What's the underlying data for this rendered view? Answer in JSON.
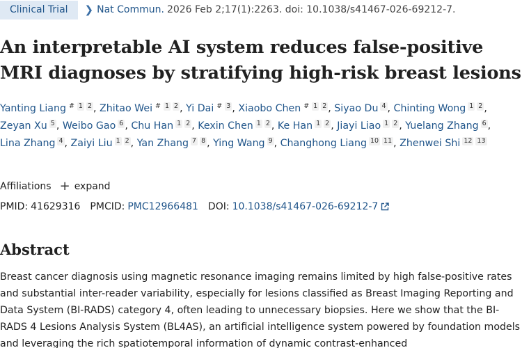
{
  "header": {
    "badge": "Clinical Trial",
    "journal": "Nat Commun.",
    "citation": "2026 Feb 2;17(1):2263. doi: 10.1038/s41467-026-69212-7."
  },
  "title": "An interpretable AI system reduces false-positive MRI diagnoses by stratifying high-risk breast lesions",
  "authors": [
    {
      "name": "Yanting Liang",
      "marks": [
        "#",
        "1",
        "2"
      ]
    },
    {
      "name": "Zhitao Wei",
      "marks": [
        "#",
        "1",
        "2"
      ]
    },
    {
      "name": "Yi Dai",
      "marks": [
        "#",
        "3"
      ]
    },
    {
      "name": "Xiaobo Chen",
      "marks": [
        "#",
        "1",
        "2"
      ]
    },
    {
      "name": "Siyao Du",
      "marks": [
        "4"
      ]
    },
    {
      "name": "Chinting Wong",
      "marks": [
        "1",
        "2"
      ]
    },
    {
      "name": "Zeyan Xu",
      "marks": [
        "5"
      ]
    },
    {
      "name": "Weibo Gao",
      "marks": [
        "6"
      ]
    },
    {
      "name": "Chu Han",
      "marks": [
        "1",
        "2"
      ]
    },
    {
      "name": "Kexin Chen",
      "marks": [
        "1",
        "2"
      ]
    },
    {
      "name": "Ke Han",
      "marks": [
        "1",
        "2"
      ]
    },
    {
      "name": "Jiayi Liao",
      "marks": [
        "1",
        "2"
      ]
    },
    {
      "name": "Yuelang Zhang",
      "marks": [
        "6"
      ]
    },
    {
      "name": "Lina Zhang",
      "marks": [
        "4"
      ]
    },
    {
      "name": "Zaiyi Liu",
      "marks": [
        "1",
        "2"
      ]
    },
    {
      "name": "Yan Zhang",
      "marks": [
        "7",
        "8"
      ]
    },
    {
      "name": "Ying Wang",
      "marks": [
        "9"
      ]
    },
    {
      "name": "Changhong Liang",
      "marks": [
        "10",
        "11"
      ]
    },
    {
      "name": "Zhenwei Shi",
      "marks": [
        "12",
        "13"
      ]
    }
  ],
  "affiliations": {
    "label": "Affiliations",
    "toggle": "expand"
  },
  "ids": {
    "pmid_label": "PMID:",
    "pmid": "41629316",
    "pmcid_label": "PMCID:",
    "pmcid": "PMC12966481",
    "doi_label": "DOI:",
    "doi": "10.1038/s41467-026-69212-7"
  },
  "abstract": {
    "heading": "Abstract",
    "text": "Breast cancer diagnosis using magnetic resonance imaging remains limited by high false-positive rates and substantial inter-reader variability, especially for lesions classified as Breast Imaging Reporting and Data System (BI-RADS) category 4, often leading to unnecessary biopsies. Here we show that the BI-RADS 4 Lesions Analysis System (BL4AS), an artificial intelligence system powered by foundation models and leveraging the rich spatiotemporal information of dynamic contrast-enhanced"
  }
}
